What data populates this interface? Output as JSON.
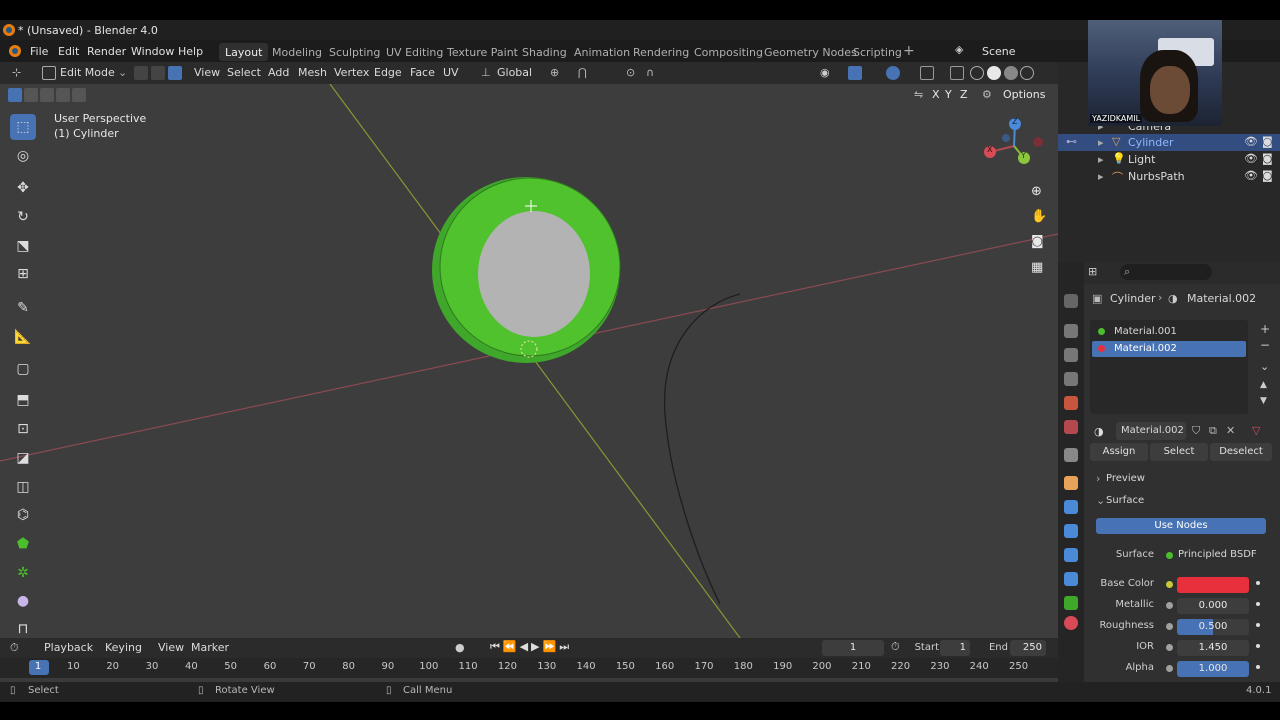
{
  "window": {
    "title": "* (Unsaved) - Blender 4.0"
  },
  "menu": {
    "file": "File",
    "edit": "Edit",
    "render": "Render",
    "window": "Window",
    "help": "Help"
  },
  "workspaces": [
    "Layout",
    "Modeling",
    "Sculpting",
    "UV Editing",
    "Texture Paint",
    "Shading",
    "Animation",
    "Rendering",
    "Compositing",
    "Geometry Nodes",
    "Scripting"
  ],
  "scene": {
    "label": "Scene"
  },
  "header3d": {
    "mode": "Edit Mode",
    "view": "View",
    "select": "Select",
    "add": "Add",
    "mesh": "Mesh",
    "vertex": "Vertex",
    "edge": "Edge",
    "face": "Face",
    "uv": "UV",
    "orientation": "Global",
    "options": "Options",
    "x": "X",
    "y": "Y",
    "z": "Z"
  },
  "viewport": {
    "perspective": "User Perspective",
    "object": "(1) Cylinder",
    "gizmo": {
      "x": "X",
      "y": "Y",
      "z": "Z"
    }
  },
  "outliner": {
    "items": [
      {
        "label": "Camera"
      },
      {
        "label": "Cylinder"
      },
      {
        "label": "Light"
      },
      {
        "label": "NurbsPath"
      }
    ]
  },
  "webcam": {
    "name": "YAZIDKAMIL"
  },
  "properties": {
    "breadcrumb_object": "Cylinder",
    "breadcrumb_material": "Material.002",
    "slots": [
      "Material.001",
      "Material.002"
    ],
    "material_name": "Material.002",
    "assign": "Assign",
    "select": "Select",
    "deselect": "Deselect",
    "preview": "Preview",
    "surface_panel": "Surface",
    "use_nodes": "Use Nodes",
    "surface_label": "Surface",
    "surface_value": "Principled BSDF",
    "base_color_label": "Base Color",
    "base_color": "#e8303c",
    "metallic_label": "Metallic",
    "metallic": "0.000",
    "roughness_label": "Roughness",
    "roughness": "0.500",
    "ior_label": "IOR",
    "ior": "1.450",
    "alpha_label": "Alpha",
    "alpha": "1.000"
  },
  "timeline": {
    "playback": "Playback",
    "keying": "Keying",
    "view": "View",
    "marker": "Marker",
    "current_frame": "1",
    "start_label": "Start",
    "start": "1",
    "end_label": "End",
    "end": "250",
    "ticks": [
      "1",
      "10",
      "20",
      "30",
      "40",
      "50",
      "60",
      "70",
      "80",
      "90",
      "100",
      "110",
      "120",
      "130",
      "140",
      "150",
      "160",
      "170",
      "180",
      "190",
      "200",
      "210",
      "220",
      "230",
      "240",
      "250"
    ]
  },
  "status": {
    "select": "Select",
    "rotate": "Rotate View",
    "call_menu": "Call Menu",
    "version": "4.0.1"
  },
  "colors": {
    "accent": "#4772b3",
    "mesh_green": "#4bbf2b",
    "axis_x": "#b3484e",
    "axis_y": "#9aa83a"
  }
}
